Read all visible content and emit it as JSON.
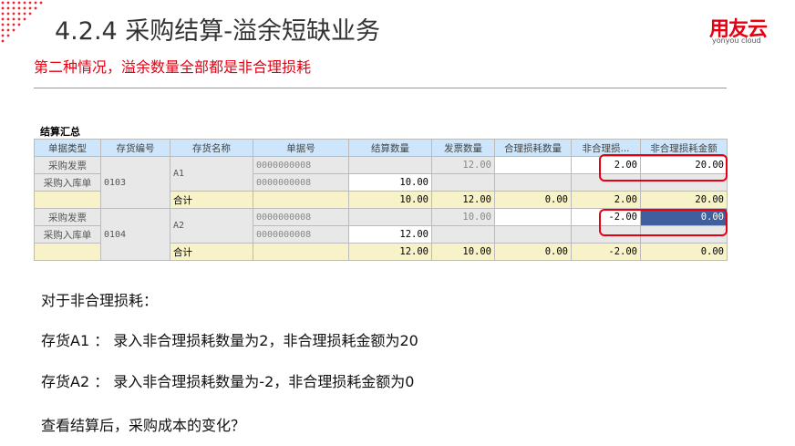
{
  "header": {
    "title": "4.2.4 采购结算-溢余短缺业务",
    "subtitle": "第二种情况，溢余数量全部都是非合理损耗",
    "logo": "用友云",
    "logo_sub": "yonyou cloud"
  },
  "sheet": {
    "title": "结算汇总",
    "columns": [
      "单据类型",
      "存货编号",
      "存货名称",
      "单据号",
      "结算数量",
      "发票数量",
      "合理损耗数量",
      "非合理损...",
      "非合理损耗金额"
    ],
    "groups": [
      {
        "code": "0103",
        "name": "A1",
        "rows": [
          {
            "type": "采购发票",
            "doc": "0000000008",
            "settle": "",
            "invoice": "12.00",
            "reasonable": "",
            "unreasonable": "2.00",
            "amount": "20.00"
          },
          {
            "type": "采购入库单",
            "doc": "0000000008",
            "settle": "10.00",
            "invoice": "",
            "reasonable": "",
            "unreasonable": "",
            "amount": ""
          }
        ],
        "total": {
          "label": "合计",
          "settle": "10.00",
          "invoice": "12.00",
          "reasonable": "0.00",
          "unreasonable": "2.00",
          "amount": "20.00"
        }
      },
      {
        "code": "0104",
        "name": "A2",
        "rows": [
          {
            "type": "采购发票",
            "doc": "0000000008",
            "settle": "",
            "invoice": "10.00",
            "reasonable": "",
            "unreasonable": "-2.00",
            "amount": "0.00"
          },
          {
            "type": "采购入库单",
            "doc": "0000000008",
            "settle": "12.00",
            "invoice": "",
            "reasonable": "",
            "unreasonable": "",
            "amount": ""
          }
        ],
        "total": {
          "label": "合计",
          "settle": "12.00",
          "invoice": "10.00",
          "reasonable": "0.00",
          "unreasonable": "-2.00",
          "amount": "0.00"
        }
      }
    ]
  },
  "body": [
    "对于非合理损耗：",
    "存货A1 ： 录入非合理损耗数量为2，非合理损耗金额为20",
    "存货A2 ：  录入非合理损耗数量为-2，非合理损耗金额为0",
    "查看结算后，采购成本的变化？"
  ],
  "colors": {
    "accent": "#e60012",
    "header": "#cde6fb",
    "total": "#f8f2c8",
    "selected": "#3f5f9f"
  }
}
